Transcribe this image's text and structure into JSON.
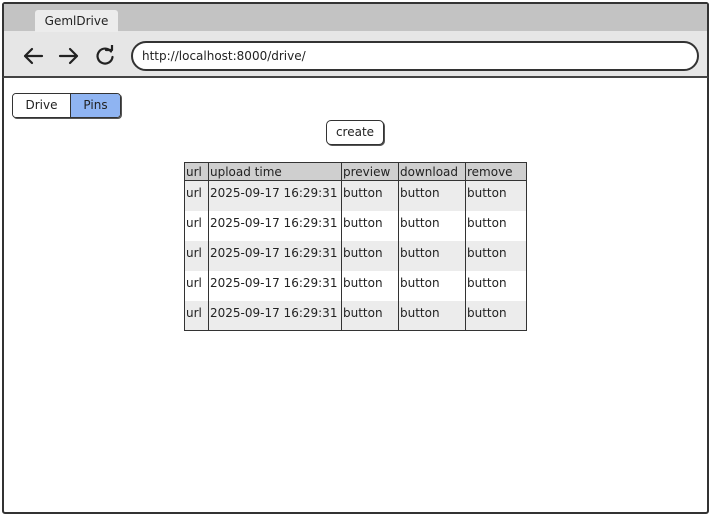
{
  "browser": {
    "tab_title": "GemlDrive",
    "url": "http://localhost:8000/drive/",
    "back_icon": "arrow-left-icon",
    "forward_icon": "arrow-right-icon",
    "reload_icon": "reload-icon"
  },
  "toggle": {
    "drive_label": "Drive",
    "pins_label": "Pins",
    "selected": "Pins",
    "selected_color": "#8fb4f2"
  },
  "create_label": "create",
  "table": {
    "headers": [
      "url",
      "upload time",
      "preview",
      "download",
      "remove"
    ],
    "rows": [
      [
        "url",
        "2025-09-17 16:29:31",
        "button",
        "button",
        "button"
      ],
      [
        "url",
        "2025-09-17 16:29:31",
        "button",
        "button",
        "button"
      ],
      [
        "url",
        "2025-09-17 16:29:31",
        "button",
        "button",
        "button"
      ],
      [
        "url",
        "2025-09-17 16:29:31",
        "button",
        "button",
        "button"
      ],
      [
        "url",
        "2025-09-17 16:29:31",
        "button",
        "button",
        "button"
      ]
    ]
  }
}
